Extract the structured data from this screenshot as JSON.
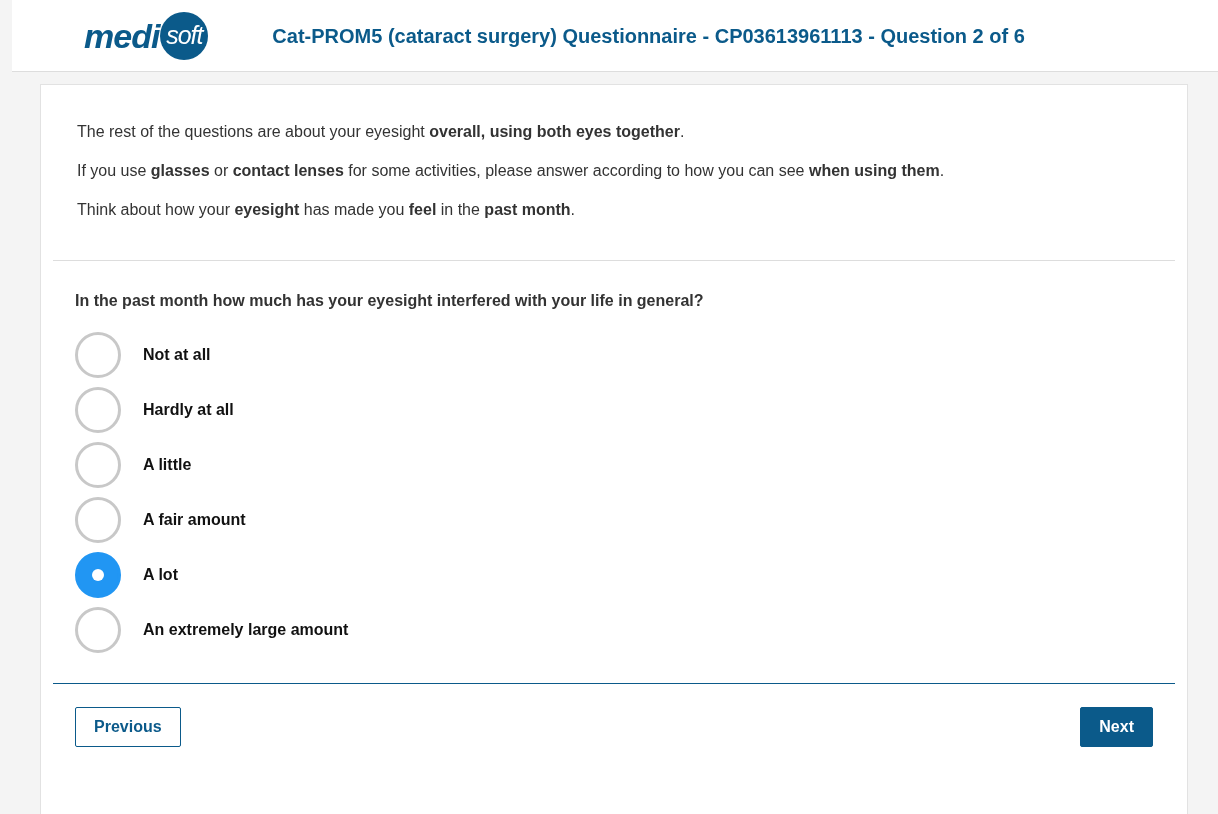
{
  "logo": {
    "word": "medi",
    "circle_word": "soft"
  },
  "header": {
    "title": "Cat-PROM5 (cataract surgery) Questionnaire - CP03613961113 - Question 2 of 6"
  },
  "intro": [
    "The rest of the questions are about your eyesight **overall, using both eyes together**.",
    "If you use **glasses** or **contact lenses** for some activities, please answer according to how you can see **when using them**.",
    "Think about how your **eyesight** has made you **feel** in the **past month**."
  ],
  "question": "In the past month how much has your eyesight interfered with your life in general?",
  "options": [
    {
      "label": "Not at all",
      "selected": false
    },
    {
      "label": "Hardly at all",
      "selected": false
    },
    {
      "label": "A little",
      "selected": false
    },
    {
      "label": "A fair amount",
      "selected": false
    },
    {
      "label": "A lot",
      "selected": true
    },
    {
      "label": "An extremely large amount",
      "selected": false
    }
  ],
  "buttons": [
    {
      "label": "Previous",
      "kind": "outline"
    },
    {
      "label": "Next",
      "kind": "solid"
    }
  ]
}
